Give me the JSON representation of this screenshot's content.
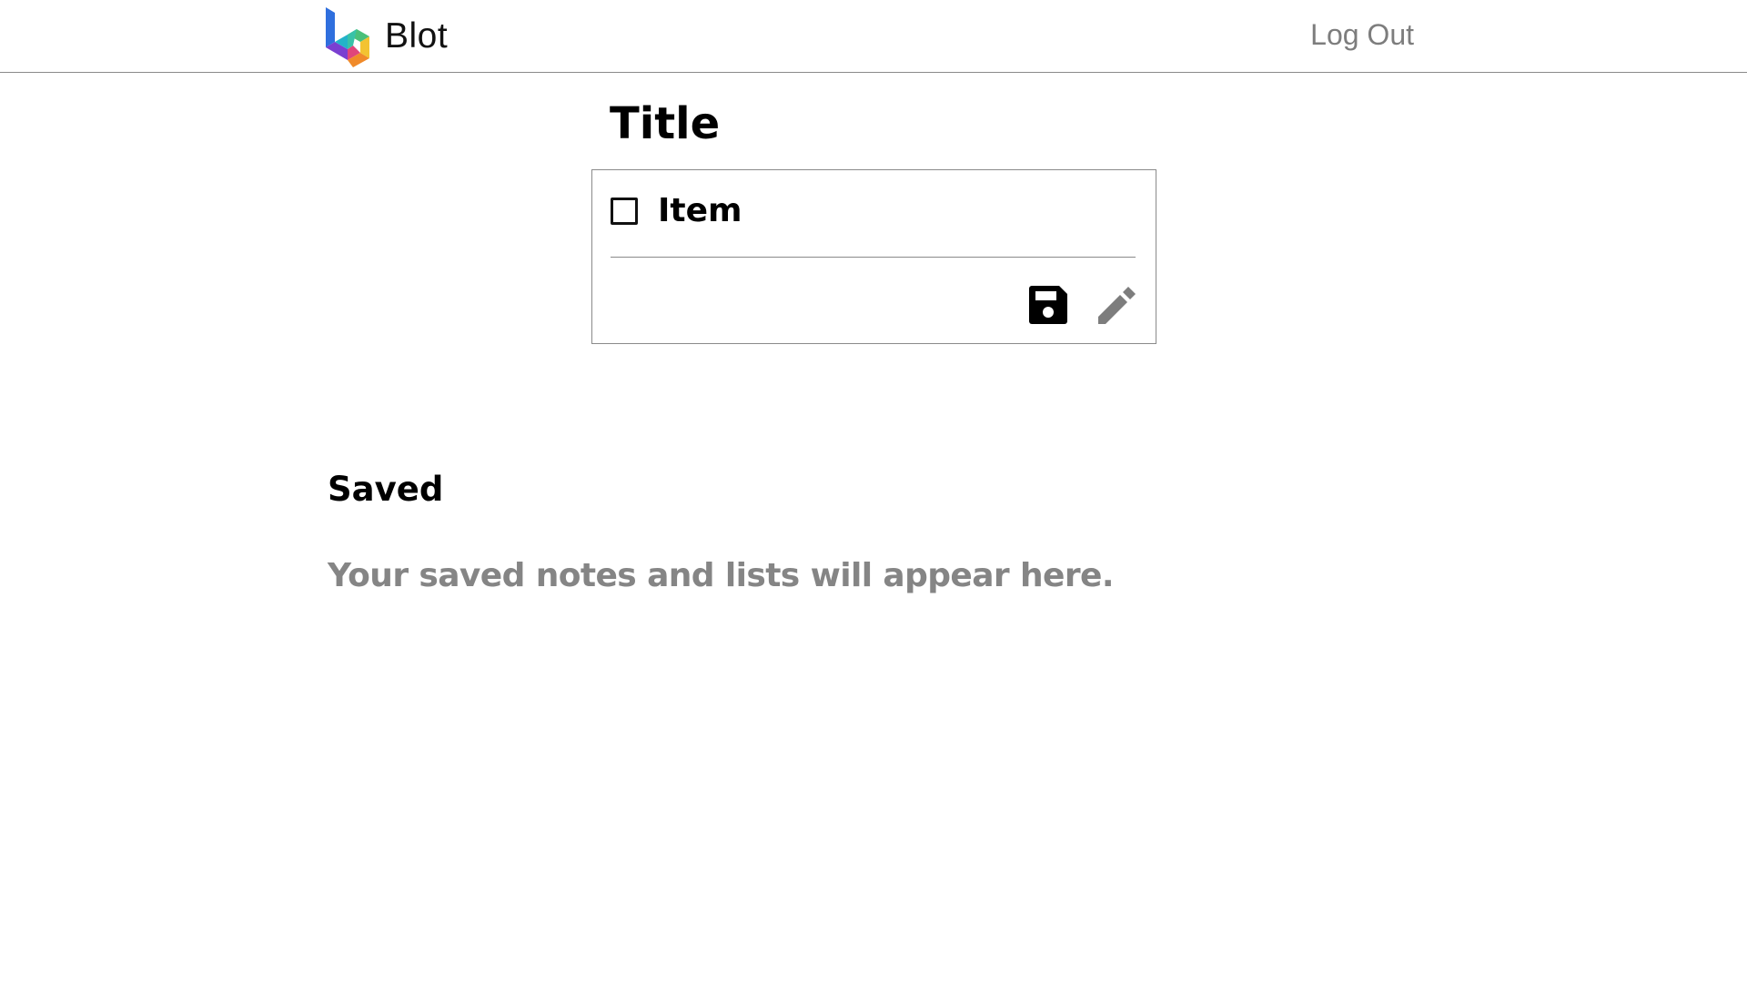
{
  "header": {
    "brand_name": "Blot",
    "logo_icon": "blot-logo-icon",
    "logout_label": "Log Out"
  },
  "note": {
    "title": "Title",
    "items": [
      {
        "label": "Item",
        "checked": false
      }
    ],
    "actions": {
      "save_icon": "floppy-disk-icon",
      "edit_icon": "pencil-icon"
    }
  },
  "saved": {
    "heading": "Saved",
    "empty_message": "Your saved notes and lists will appear here."
  },
  "colors": {
    "text": "#000000",
    "muted": "#7d7d7d",
    "border": "#8a8a8a",
    "background": "#ffffff"
  }
}
